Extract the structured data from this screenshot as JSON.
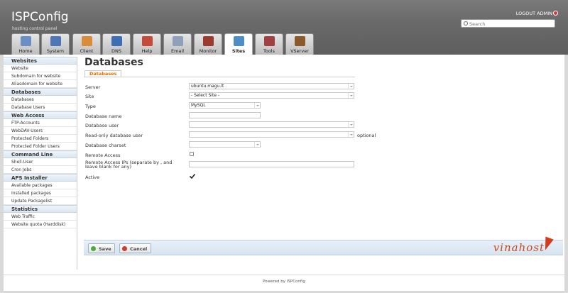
{
  "header": {
    "logo": "ISPConfig",
    "tagline": "hosting control panel",
    "logout": "LOGOUT ADMIN",
    "search_placeholder": "Search"
  },
  "tabs": [
    {
      "label": "Home",
      "icon": "home-icon",
      "color": "#6a8fc4"
    },
    {
      "label": "System",
      "icon": "system-icon",
      "color": "#4f77b8"
    },
    {
      "label": "Client",
      "icon": "client-icon",
      "color": "#d98c3a"
    },
    {
      "label": "DNS",
      "icon": "dns-icon",
      "color": "#3d6fb5"
    },
    {
      "label": "Help",
      "icon": "help-icon",
      "color": "#c44a3a"
    },
    {
      "label": "Email",
      "icon": "email-icon",
      "color": "#8fa0bb"
    },
    {
      "label": "Monitor",
      "icon": "monitor-icon",
      "color": "#9b3a2f"
    },
    {
      "label": "Sites",
      "icon": "sites-icon",
      "color": "#4d8ec7",
      "active": true
    },
    {
      "label": "Tools",
      "icon": "tools-icon",
      "color": "#a04040"
    },
    {
      "label": "VServer",
      "icon": "vserver-icon",
      "color": "#8b5a2b"
    }
  ],
  "sidebar": {
    "sections": [
      {
        "title": "Websites",
        "items": [
          "Website",
          "Subdomain for website",
          "Aliasdomain for website"
        ]
      },
      {
        "title": "Databases",
        "items": [
          "Databases",
          "Database Users"
        ]
      },
      {
        "title": "Web Access",
        "items": [
          "FTP-Accounts",
          "WebDAV-Users",
          "Protected Folders",
          "Protected Folder Users"
        ]
      },
      {
        "title": "Command Line",
        "items": [
          "Shell-User",
          "Cron Jobs"
        ]
      },
      {
        "title": "APS Installer",
        "items": [
          "Available packages",
          "Installed packages",
          "Update Packagelist"
        ]
      },
      {
        "title": "Statistics",
        "items": [
          "Web Traffic",
          "Website quota (Harddisk)"
        ]
      }
    ]
  },
  "main": {
    "title": "Databases",
    "subtab": "Databases",
    "form": {
      "server_label": "Server",
      "server_value": "ubuntu.magu.lt",
      "site_label": "Site",
      "site_value": "- Select Site -",
      "type_label": "Type",
      "type_value": "MySQL",
      "dbname_label": "Database name",
      "dbuser_label": "Database user",
      "rodbuser_label": "Read-only database user",
      "optional_note": "optional",
      "charset_label": "Database charset",
      "remote_label": "Remote Access",
      "remote_ips_label_1": "Remote Access IPs (separate by , and",
      "remote_ips_label_2": "leave blank for any)",
      "active_label": "Active"
    },
    "buttons": {
      "save": "Save",
      "cancel": "Cancel"
    }
  },
  "watermark": "vinahost",
  "footer": "Powered by ISPConfig"
}
